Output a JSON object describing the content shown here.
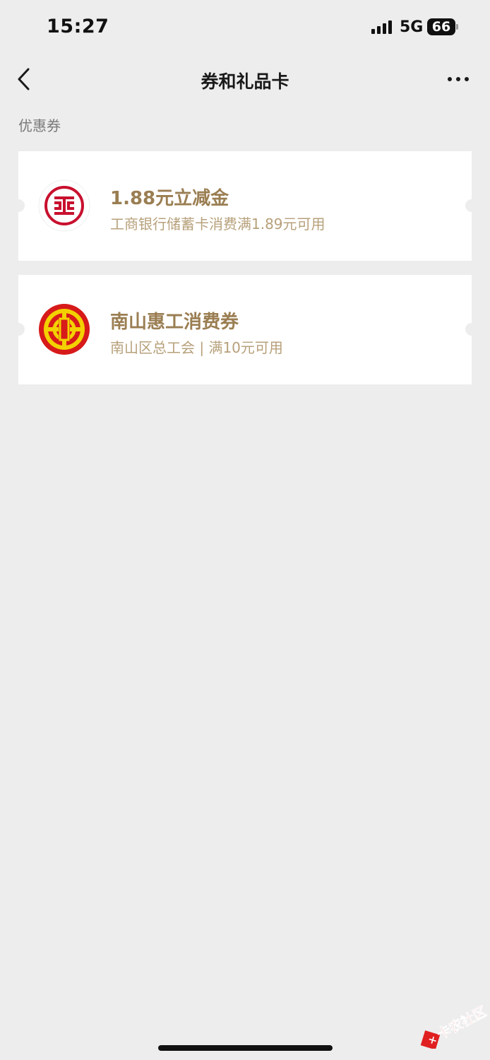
{
  "status_bar": {
    "time": "15:27",
    "network": "5G",
    "battery": "66"
  },
  "nav": {
    "title": "券和礼品卡"
  },
  "section": {
    "label": "优惠券"
  },
  "coupons": [
    {
      "title": "1.88元立减金",
      "description": "工商银行储蓄卡消费满1.89元可用",
      "logo_icon": "icbc-logo-icon",
      "logo_color": "#c8102e"
    },
    {
      "title": "南山惠工消费券",
      "description": "南山区总工会 | 满10元可用",
      "logo_icon": "trade-union-logo-icon",
      "logo_color": "#d71a1a"
    }
  ],
  "colors": {
    "page_bg": "#ededed",
    "coupon_title": "#9a7e52",
    "coupon_desc": "#b7a07a"
  },
  "watermark": {
    "text": "卡农社区"
  }
}
